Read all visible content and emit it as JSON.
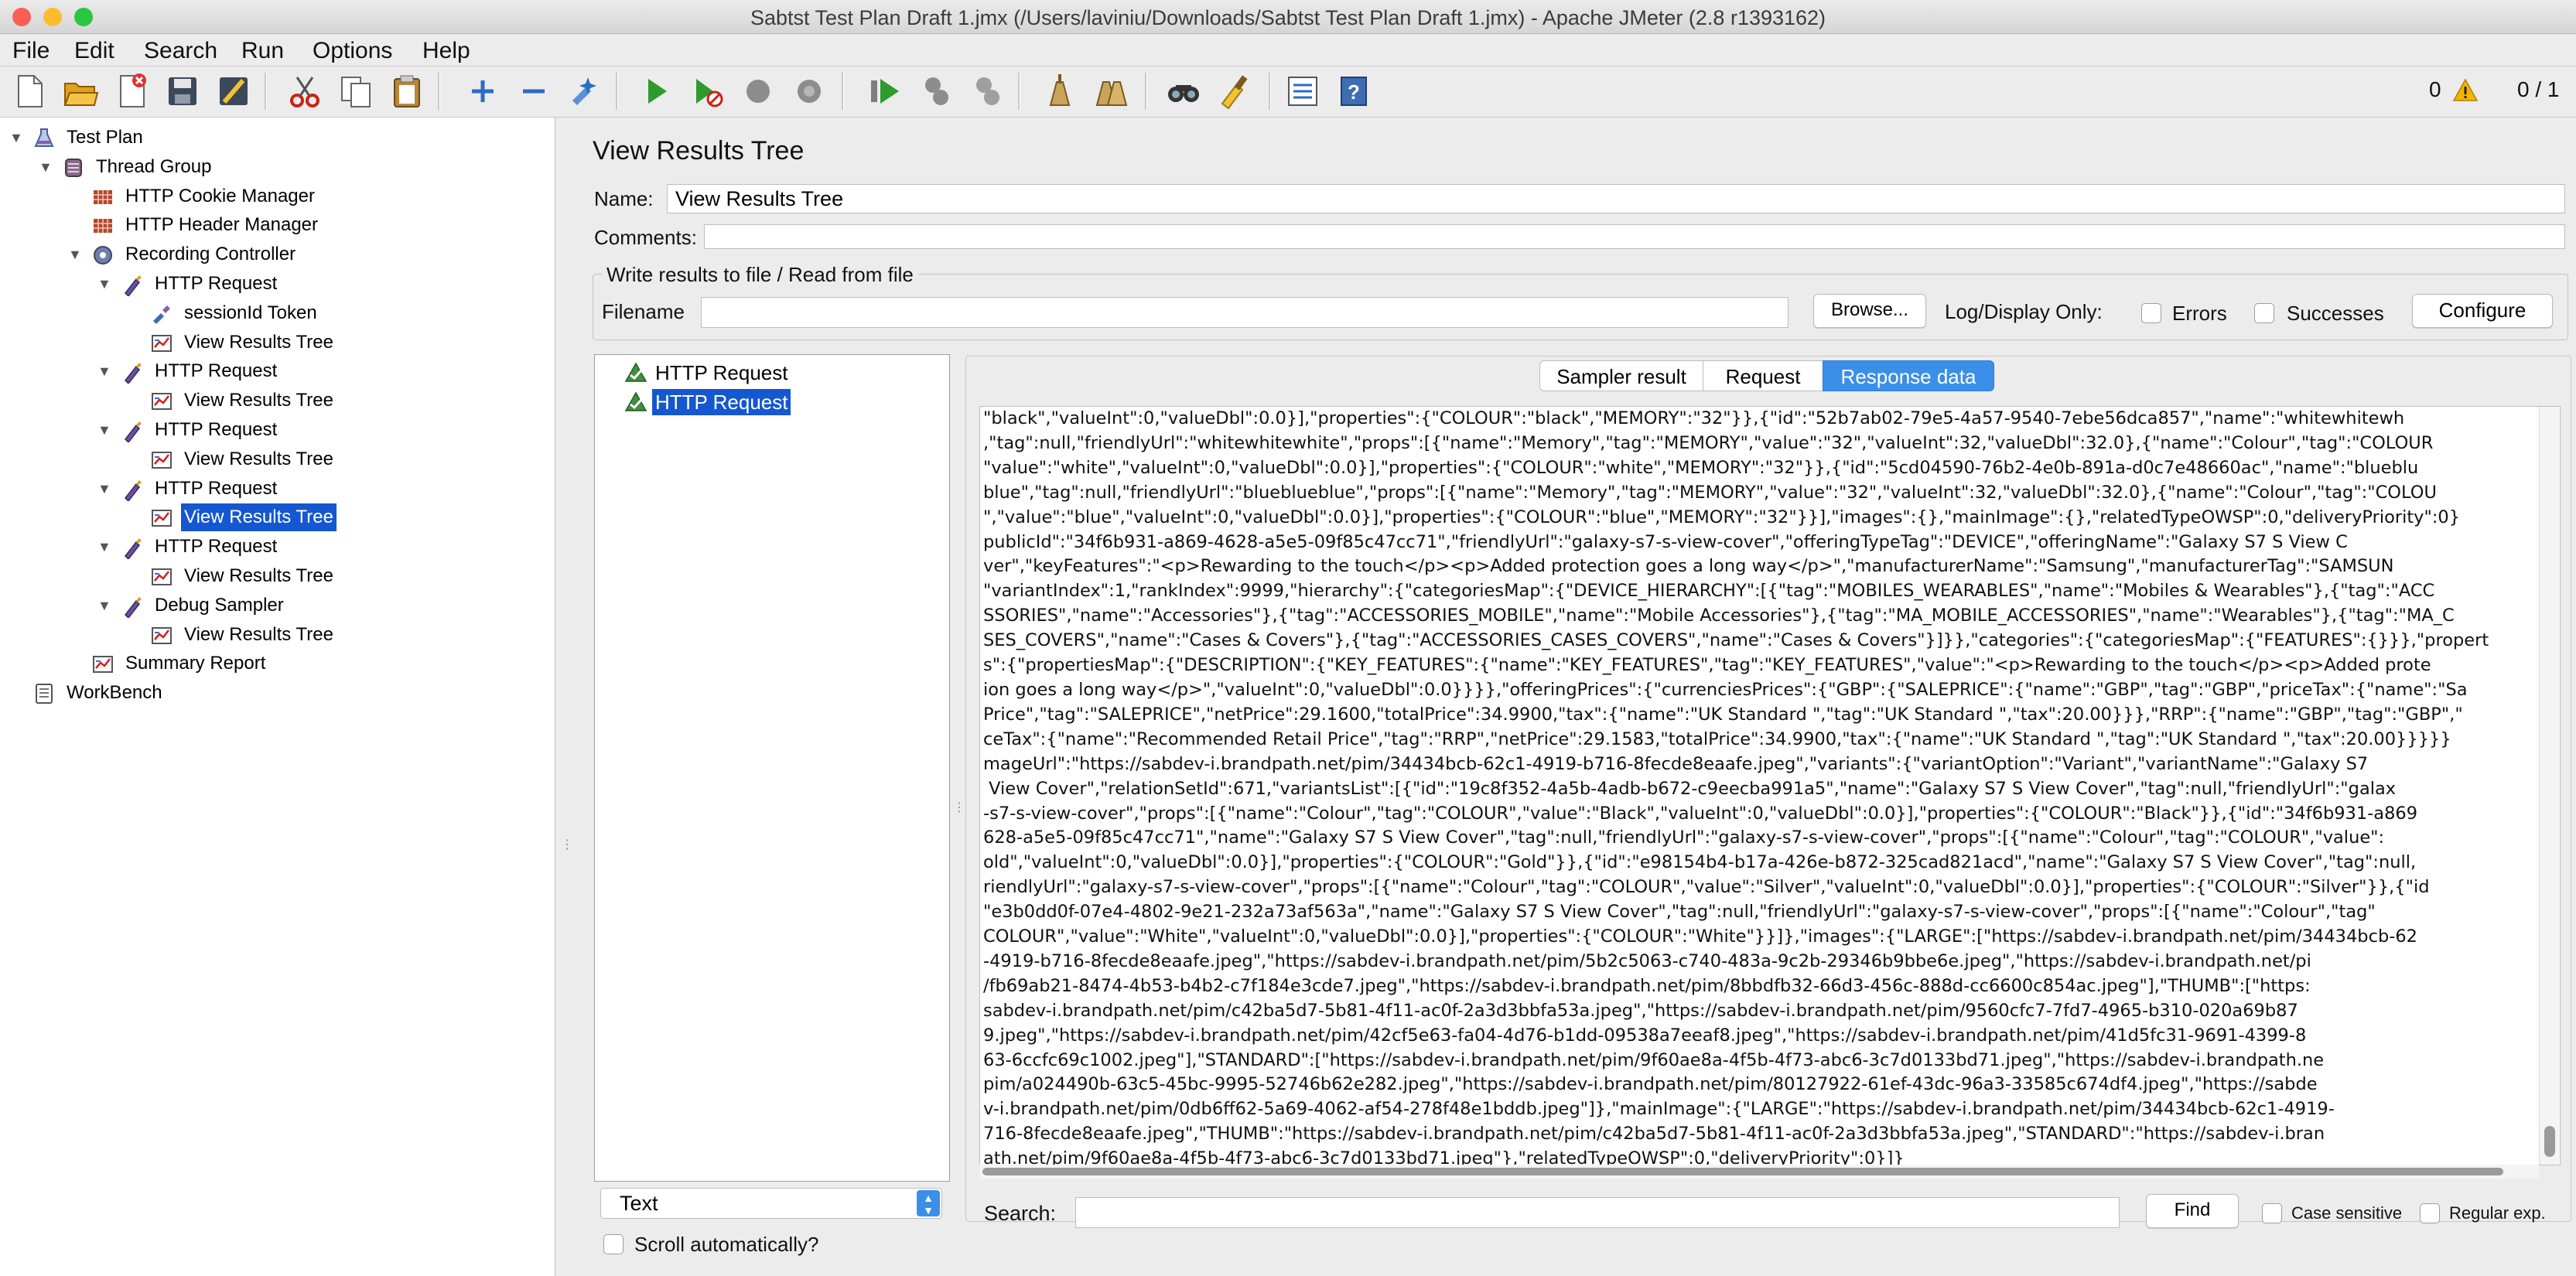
{
  "window": {
    "title": "Sabtst Test Plan Draft 1.jmx (/Users/laviniu/Downloads/Sabtst Test Plan Draft 1.jmx) - Apache JMeter (2.8 r1393162)",
    "traffic_colors": [
      "#fd5f57",
      "#fdbc2e",
      "#29c73f"
    ]
  },
  "menu": [
    "File",
    "Edit",
    "Search",
    "Run",
    "Options",
    "Help"
  ],
  "toolbar": {
    "warning_count": "0",
    "threads": "0 / 1",
    "icons": [
      "new-icon",
      "open-icon",
      "close-icon",
      "save-icon",
      "save-screenshot-icon",
      "cut-icon",
      "copy-icon",
      "paste-icon",
      "expand-icon",
      "collapse-icon",
      "toggle-icon",
      "start-icon",
      "start-no-timers-icon",
      "stop-icon",
      "shutdown-icon",
      "remote-start-icon",
      "remote-stop-icon",
      "remote-shutdown-icon",
      "clear-icon",
      "clear-all-icon",
      "search-icon",
      "reset-search-icon",
      "function-helper-icon",
      "help-icon"
    ]
  },
  "tree": [
    {
      "label": "Test Plan",
      "icon": "test-plan-icon",
      "toggle": "▼",
      "selected": false
    },
    {
      "label": "Thread Group",
      "icon": "thread-group-icon",
      "toggle": "▼",
      "selected": false
    },
    {
      "label": "HTTP Cookie Manager",
      "icon": "config-element-icon",
      "toggle": "",
      "selected": false
    },
    {
      "label": "HTTP Header Manager",
      "icon": "config-element-icon",
      "toggle": "",
      "selected": false
    },
    {
      "label": "Recording Controller",
      "icon": "controller-icon",
      "toggle": "▼",
      "selected": false
    },
    {
      "label": "HTTP Request",
      "icon": "sampler-icon",
      "toggle": "▼",
      "selected": false
    },
    {
      "label": "sessionId Token",
      "icon": "extractor-icon",
      "toggle": "",
      "selected": false
    },
    {
      "label": "View Results Tree",
      "icon": "listener-icon",
      "toggle": "",
      "selected": false
    },
    {
      "label": "HTTP Request",
      "icon": "sampler-icon",
      "toggle": "▼",
      "selected": false
    },
    {
      "label": "View Results Tree",
      "icon": "listener-icon",
      "toggle": "",
      "selected": false
    },
    {
      "label": "HTTP Request",
      "icon": "sampler-icon",
      "toggle": "▼",
      "selected": false
    },
    {
      "label": "View Results Tree",
      "icon": "listener-icon",
      "toggle": "",
      "selected": false
    },
    {
      "label": "HTTP Request",
      "icon": "sampler-icon",
      "toggle": "▼",
      "selected": false
    },
    {
      "label": "View Results Tree",
      "icon": "listener-icon",
      "toggle": "",
      "selected": true
    },
    {
      "label": "HTTP Request",
      "icon": "sampler-icon",
      "toggle": "▼",
      "selected": false
    },
    {
      "label": "View Results Tree",
      "icon": "listener-icon",
      "toggle": "",
      "selected": false
    },
    {
      "label": "Debug Sampler",
      "icon": "sampler-icon",
      "toggle": "▼",
      "selected": false
    },
    {
      "label": "View Results Tree",
      "icon": "listener-icon",
      "toggle": "",
      "selected": false
    },
    {
      "label": "Summary Report",
      "icon": "listener-icon",
      "toggle": "",
      "selected": false
    },
    {
      "label": "WorkBench",
      "icon": "workbench-icon",
      "toggle": "",
      "selected": false
    }
  ],
  "panel": {
    "heading": "View Results Tree",
    "name_label": "Name:",
    "name_value": "View Results Tree",
    "comments_label": "Comments:",
    "file_group_title": "Write results to file / Read from file",
    "filename_label": "Filename",
    "filename_value": "",
    "browse": "Browse...",
    "log_display_only": "Log/Display Only:",
    "errors": "Errors",
    "successes": "Successes",
    "configure": "Configure"
  },
  "results": {
    "items": [
      {
        "label": "HTTP Request",
        "selected": false
      },
      {
        "label": "HTTP Request",
        "selected": true
      }
    ],
    "renderer": "Text",
    "scroll_auto": "Scroll automatically?"
  },
  "tabs": [
    {
      "label": "Sampler result",
      "active": false
    },
    {
      "label": "Request",
      "active": false
    },
    {
      "label": "Response data",
      "active": true
    }
  ],
  "response_lines": [
    "\"black\",\"valueInt\":0,\"valueDbl\":0.0}],\"properties\":{\"COLOUR\":\"black\",\"MEMORY\":\"32\"}},{\"id\":\"52b7ab02-79e5-4a57-9540-7ebe56dca857\",\"name\":\"whitewhitewh",
    ",\"tag\":null,\"friendlyUrl\":\"whitewhitewhite\",\"props\":[{\"name\":\"Memory\",\"tag\":\"MEMORY\",\"value\":\"32\",\"valueInt\":32,\"valueDbl\":32.0},{\"name\":\"Colour\",\"tag\":\"COLOUR",
    "\"value\":\"white\",\"valueInt\":0,\"valueDbl\":0.0}],\"properties\":{\"COLOUR\":\"white\",\"MEMORY\":\"32\"}},{\"id\":\"5cd04590-76b2-4e0b-891a-d0c7e48660ac\",\"name\":\"blueblu",
    "blue\",\"tag\":null,\"friendlyUrl\":\"blueblueblue\",\"props\":[{\"name\":\"Memory\",\"tag\":\"MEMORY\",\"value\":\"32\",\"valueInt\":32,\"valueDbl\":32.0},{\"name\":\"Colour\",\"tag\":\"COLOU",
    "\",\"value\":\"blue\",\"valueInt\":0,\"valueDbl\":0.0}],\"properties\":{\"COLOUR\":\"blue\",\"MEMORY\":\"32\"}}],\"images\":{},\"mainImage\":{},\"relatedTypeOWSP\":0,\"deliveryPriority\":0}",
    "publicId\":\"34f6b931-a869-4628-a5e5-09f85c47cc71\",\"friendlyUrl\":\"galaxy-s7-s-view-cover\",\"offeringTypeTag\":\"DEVICE\",\"offeringName\":\"Galaxy S7 S View C",
    "ver\",\"keyFeatures\":\"<p>Rewarding to the touch</p><p>Added protection goes a long way</p>\",\"manufacturerName\":\"Samsung\",\"manufacturerTag\":\"SAMSUN",
    "\"variantIndex\":1,\"rankIndex\":9999,\"hierarchy\":{\"categoriesMap\":{\"DEVICE_HIERARCHY\":[{\"tag\":\"MOBILES_WEARABLES\",\"name\":\"Mobiles & Wearables\"},{\"tag\":\"ACC",
    "SSORIES\",\"name\":\"Accessories\"},{\"tag\":\"ACCESSORIES_MOBILE\",\"name\":\"Mobile Accessories\"},{\"tag\":\"MA_MOBILE_ACCESSORIES\",\"name\":\"Wearables\"},{\"tag\":\"MA_C",
    "SES_COVERS\",\"name\":\"Cases & Covers\"},{\"tag\":\"ACCESSORIES_CASES_COVERS\",\"name\":\"Cases & Covers\"}]}},\"categories\":{\"categoriesMap\":{\"FEATURES\":{}}},\"propert",
    "s\":{\"propertiesMap\":{\"DESCRIPTION\":{\"KEY_FEATURES\":{\"name\":\"KEY_FEATURES\",\"tag\":\"KEY_FEATURES\",\"value\":\"<p>Rewarding to the touch</p><p>Added prote",
    "ion goes a long way</p>\",\"valueInt\":0,\"valueDbl\":0.0}}}},\"offeringPrices\":{\"currenciesPrices\":{\"GBP\":{\"SALEPRICE\":{\"name\":\"GBP\",\"tag\":\"GBP\",\"priceTax\":{\"name\":\"Sa",
    "Price\",\"tag\":\"SALEPRICE\",\"netPrice\":29.1600,\"totalPrice\":34.9900,\"tax\":{\"name\":\"UK Standard \",\"tag\":\"UK Standard \",\"tax\":20.00}}},\"RRP\":{\"name\":\"GBP\",\"tag\":\"GBP\",\"",
    "ceTax\":{\"name\":\"Recommended Retail Price\",\"tag\":\"RRP\",\"netPrice\":29.1583,\"totalPrice\":34.9900,\"tax\":{\"name\":\"UK Standard \",\"tag\":\"UK Standard \",\"tax\":20.00}}}}}",
    "mageUrl\":\"https://sabdev-i.brandpath.net/pim/34434bcb-62c1-4919-b716-8fecde8eaafe.jpeg\",\"variants\":{\"variantOption\":\"Variant\",\"variantName\":\"Galaxy S7",
    " View Cover\",\"relationSetId\":671,\"variantsList\":[{\"id\":\"19c8f352-4a5b-4adb-b672-c9eecba991a5\",\"name\":\"Galaxy S7 S View Cover\",\"tag\":null,\"friendlyUrl\":\"galax",
    "-s7-s-view-cover\",\"props\":[{\"name\":\"Colour\",\"tag\":\"COLOUR\",\"value\":\"Black\",\"valueInt\":0,\"valueDbl\":0.0}],\"properties\":{\"COLOUR\":\"Black\"}},{\"id\":\"34f6b931-a869",
    "628-a5e5-09f85c47cc71\",\"name\":\"Galaxy S7 S View Cover\",\"tag\":null,\"friendlyUrl\":\"galaxy-s7-s-view-cover\",\"props\":[{\"name\":\"Colour\",\"tag\":\"COLOUR\",\"value\":",
    "old\",\"valueInt\":0,\"valueDbl\":0.0}],\"properties\":{\"COLOUR\":\"Gold\"}},{\"id\":\"e98154b4-b17a-426e-b872-325cad821acd\",\"name\":\"Galaxy S7 S View Cover\",\"tag\":null,",
    "riendlyUrl\":\"galaxy-s7-s-view-cover\",\"props\":[{\"name\":\"Colour\",\"tag\":\"COLOUR\",\"value\":\"Silver\",\"valueInt\":0,\"valueDbl\":0.0}],\"properties\":{\"COLOUR\":\"Silver\"}},{\"id",
    "\"e3b0dd0f-07e4-4802-9e21-232a73af563a\",\"name\":\"Galaxy S7 S View Cover\",\"tag\":null,\"friendlyUrl\":\"galaxy-s7-s-view-cover\",\"props\":[{\"name\":\"Colour\",\"tag\"",
    "COLOUR\",\"value\":\"White\",\"valueInt\":0,\"valueDbl\":0.0}],\"properties\":{\"COLOUR\":\"White\"}}]},\"images\":{\"LARGE\":[\"https://sabdev-i.brandpath.net/pim/34434bcb-62",
    "-4919-b716-8fecde8eaafe.jpeg\",\"https://sabdev-i.brandpath.net/pim/5b2c5063-c740-483a-9c2b-29346b9bbe6e.jpeg\",\"https://sabdev-i.brandpath.net/pi",
    "/fb69ab21-8474-4b53-b4b2-c7f184e3cde7.jpeg\",\"https://sabdev-i.brandpath.net/pim/8bbdfb32-66d3-456c-888d-cc6600c854ac.jpeg\"],\"THUMB\":[\"https:",
    "sabdev-i.brandpath.net/pim/c42ba5d7-5b81-4f11-ac0f-2a3d3bbfa53a.jpeg\",\"https://sabdev-i.brandpath.net/pim/9560cfc7-7fd7-4965-b310-020a69b87",
    "9.jpeg\",\"https://sabdev-i.brandpath.net/pim/42cf5e63-fa04-4d76-b1dd-09538a7eeaf8.jpeg\",\"https://sabdev-i.brandpath.net/pim/41d5fc31-9691-4399-8",
    "63-6ccfc69c1002.jpeg\"],\"STANDARD\":[\"https://sabdev-i.brandpath.net/pim/9f60ae8a-4f5b-4f73-abc6-3c7d0133bd71.jpeg\",\"https://sabdev-i.brandpath.ne",
    "pim/a024490b-63c5-45bc-9995-52746b62e282.jpeg\",\"https://sabdev-i.brandpath.net/pim/80127922-61ef-43dc-96a3-33585c674df4.jpeg\",\"https://sabde",
    "v-i.brandpath.net/pim/0db6ff62-5a69-4062-af54-278f48e1bddb.jpeg\"]},\"mainImage\":{\"LARGE\":\"https://sabdev-i.brandpath.net/pim/34434bcb-62c1-4919-",
    "716-8fecde8eaafe.jpeg\",\"THUMB\":\"https://sabdev-i.brandpath.net/pim/c42ba5d7-5b81-4f11-ac0f-2a3d3bbfa53a.jpeg\",\"STANDARD\":\"https://sabdev-i.bran",
    "ath.net/pim/9f60ae8a-4f5b-4f73-abc6-3c7d0133bd71.jpeg\"},\"relatedTypeOWSP\":0,\"deliveryPriority\":0}]}"
  ],
  "search": {
    "label": "Search:",
    "value": "",
    "find": "Find",
    "case_sensitive": "Case sensitive",
    "regular_exp": "Regular exp."
  },
  "colors": {
    "selection": "#1557d0",
    "tab_active": "#3b8fe8",
    "warning": "#f5b400"
  }
}
